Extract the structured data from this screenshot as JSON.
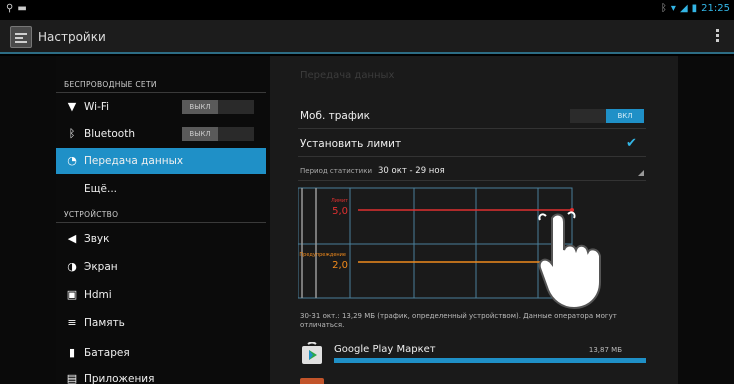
{
  "status_bar": {
    "time": "21:25"
  },
  "action_bar": {
    "title": "Настройки"
  },
  "sidebar": {
    "sections": [
      {
        "header": "БЕСПРОВОДНЫЕ СЕТИ"
      },
      {
        "header": "УСТРОЙСТВО"
      }
    ],
    "items": [
      {
        "label": "Wi-Fi",
        "icon": "wifi-icon",
        "toggle": "ВЫКЛ"
      },
      {
        "label": "Bluetooth",
        "icon": "bluetooth-icon",
        "toggle": "ВЫКЛ"
      },
      {
        "label": "Передача данных",
        "icon": "data-usage-icon",
        "active": true
      },
      {
        "label": "Ещё..."
      },
      {
        "label": "Звук",
        "icon": "sound-icon"
      },
      {
        "label": "Экран",
        "icon": "display-icon"
      },
      {
        "label": "Hdmi",
        "icon": "hdmi-icon"
      },
      {
        "label": "Память",
        "icon": "storage-icon"
      },
      {
        "label": "Батарея",
        "icon": "battery-icon"
      },
      {
        "label": "Приложения",
        "icon": "apps-icon"
      }
    ]
  },
  "main": {
    "title": "Передача данных",
    "mobile_traffic": {
      "label": "Моб. трафик",
      "toggle": "ВКЛ",
      "enabled": true
    },
    "set_limit": {
      "label": "Установить лимит",
      "checked": true
    },
    "period": {
      "label": "Период статистики",
      "value": "30 окт - 29 ноя"
    },
    "chart": {
      "limit": {
        "label": "Лимит",
        "value": "5,0"
      },
      "warning": {
        "label": "Предупреждение",
        "value": "2,0"
      }
    },
    "note": "30-31 окт.: 13,29 МБ (трафик, определенный устройством). Данные оператора могут отличаться.",
    "apps": [
      {
        "name": "Google Play Маркет",
        "size": "13,87 МБ",
        "icon": "play-store-icon"
      }
    ]
  },
  "colors": {
    "accent": "#1f90c7",
    "limit_line": "#e03030",
    "warning_line": "#f08a1c",
    "grid": "#4a7f9a"
  }
}
